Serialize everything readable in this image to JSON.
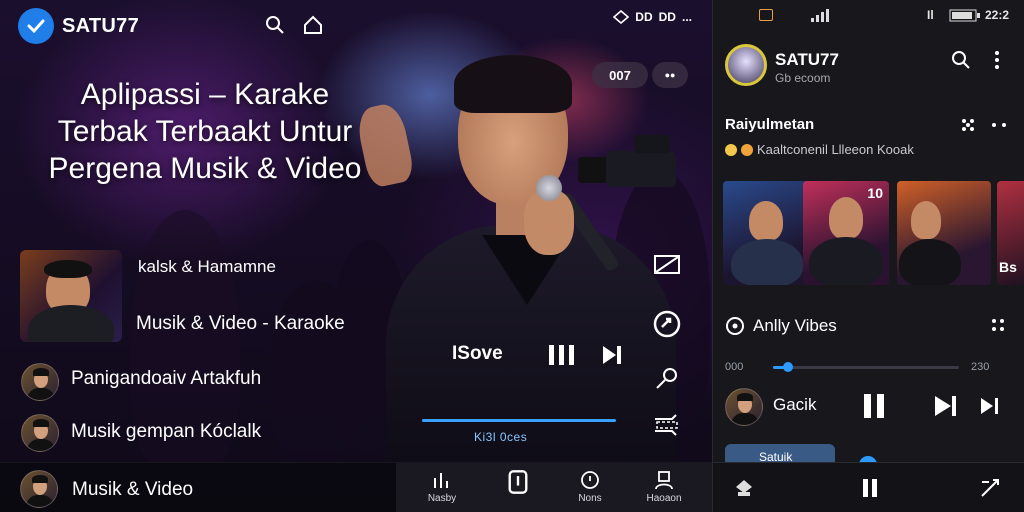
{
  "app": {
    "brand": "SATU77",
    "headline": "Aplipassi – Karake Terbak Terbaakt Untur Pergena Musik & Video",
    "status_left": [
      "DD",
      "DD",
      "..."
    ],
    "pill_count": "007",
    "pill_dots": "●●"
  },
  "list": {
    "items": [
      {
        "label": "kalsk & Hamamne"
      },
      {
        "label": "Musik & Video - Karaoke"
      },
      {
        "label": "Panigandoaiv Artakfuh"
      },
      {
        "label": "Musik gempan Kóclalk"
      }
    ]
  },
  "player": {
    "label": "ISove",
    "time": "Ki3l 0ces",
    "progress": 0.95
  },
  "bottombar": {
    "now": "Musik & Video",
    "nav": [
      {
        "label": "Nasby",
        "icon": "chart-icon"
      },
      {
        "label": "",
        "icon": "phone-icon"
      },
      {
        "label": "Nons",
        "icon": "clock-icon"
      },
      {
        "label": "Haoaon",
        "icon": "user-icon"
      }
    ]
  },
  "panel": {
    "status_time": "22:2",
    "status_battery": "B",
    "status_signal": "Il",
    "name": "SATU77",
    "subtitle": "Gb ecoom",
    "section_title": "Raiyulmetan",
    "section_sub": "Kaaltconenil Llleeon Kooak",
    "thumb_badge": "10",
    "thumb_last": "Bs",
    "vibes_title": "Anlly Vibes",
    "time_start": "000",
    "time_end": "230",
    "track_name": "Gacik",
    "chip_text": "Satuik"
  },
  "colors": {
    "accent": "#2b9bff",
    "brand_blue": "#1f7ee8",
    "avatar_ring": "#d9c83b"
  }
}
